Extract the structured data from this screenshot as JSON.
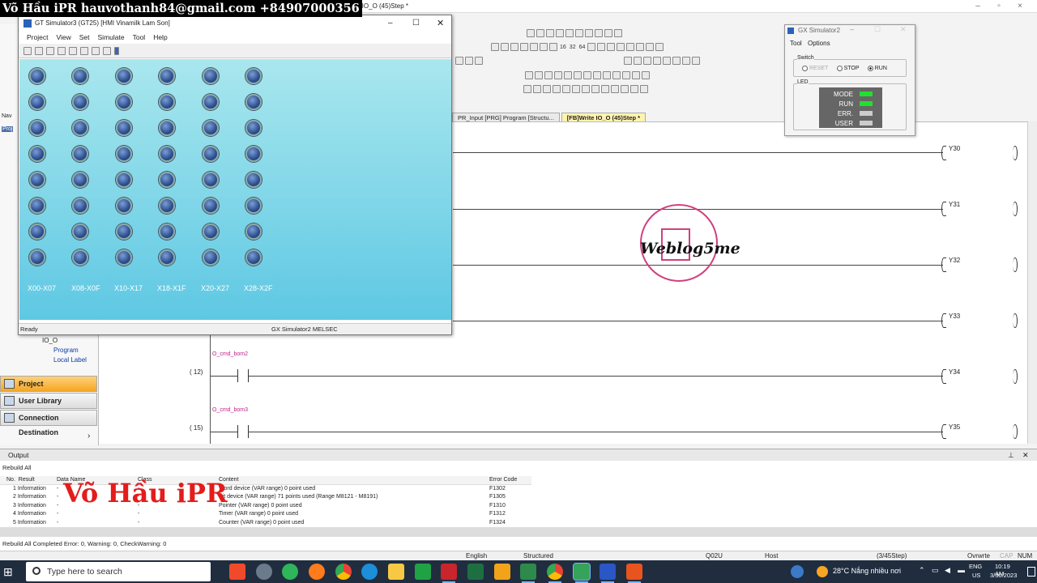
{
  "banner": {
    "text": "Võ Hầu iPR hauvothanh84@gmail.com +84907000356"
  },
  "ide": {
    "title": "e IO_O (45)Step *",
    "tabs": [
      {
        "label": "PR_Input [PRG] Program [Structu..."
      },
      {
        "label": "[FB]Write IO_O (45)Step *"
      }
    ],
    "toolbar_text": [
      "16",
      "32",
      "64"
    ],
    "coils": [
      "Y30",
      "Y31",
      "Y32",
      "Y33",
      "Y34",
      "Y35"
    ],
    "steps": [
      "(    12)",
      "(    15)"
    ],
    "contacts": [
      "O_cmd_bom2",
      "O_cmd_bom3"
    ]
  },
  "navigator": {
    "tree": {
      "folder": "IO_O",
      "program": "Program",
      "local_label": "Local Label"
    },
    "buttons": [
      "Project",
      "User Library",
      "Connection Destination"
    ],
    "side_labels": [
      "Nav",
      "Proj"
    ]
  },
  "gt_sim": {
    "title": "GT Simulator3 (GT25)  [HMI Vinamilk Lam Son]",
    "menu": [
      "Project",
      "View",
      "Set",
      "Simulate",
      "Tool",
      "Help"
    ],
    "columns": [
      "X00-X07",
      "X08-X0F",
      "X10-X17",
      "X18-X1F",
      "X20-X27",
      "X28-X2F"
    ],
    "lamp_rows": 8,
    "status_left": "Ready",
    "status_right": "GX Simulator2   MELSEC"
  },
  "gx_sim": {
    "title": "GX Simulator2",
    "menu": [
      "Tool",
      "Options"
    ],
    "switch_label": "Switch",
    "switch_options": [
      "RESET",
      "STOP",
      "RUN"
    ],
    "switch_selected": "RUN",
    "led_label": "LED",
    "leds": [
      {
        "name": "MODE",
        "color": "#22e02e"
      },
      {
        "name": "RUN",
        "color": "#22e02e"
      },
      {
        "name": "ERR.",
        "color": "#cccccc"
      },
      {
        "name": "USER",
        "color": "#cccccc"
      }
    ]
  },
  "watermark": {
    "text": "Weblog5me",
    "overlay": "Võ Hầu iPR"
  },
  "output": {
    "title": "Output",
    "subtitle": "Rebuild All",
    "headers": [
      "No.",
      "Result",
      "Data Name",
      "Class",
      "Content",
      "Error Code"
    ],
    "rows": [
      {
        "no": "1",
        "result": "Information",
        "data": "-",
        "cls": "-",
        "content": "Word device (VAR range) 0 point used",
        "code": "F1302"
      },
      {
        "no": "2",
        "result": "Information",
        "data": "-",
        "cls": "-",
        "content": "Bit device (VAR range) 71 points used (Range M8121 - M8191)",
        "code": "F1305"
      },
      {
        "no": "3",
        "result": "Information",
        "data": "-",
        "cls": "-",
        "content": "Pointer (VAR range) 0 point used",
        "code": "F1310"
      },
      {
        "no": "4",
        "result": "Information",
        "data": "-",
        "cls": "-",
        "content": "Timer (VAR range) 0 point used",
        "code": "F1312"
      },
      {
        "no": "5",
        "result": "Information",
        "data": "-",
        "cls": "-",
        "content": "Counter (VAR range) 0 point used",
        "code": "F1324"
      }
    ],
    "footer": "Rebuild All Completed Error: 0, Warning: 0, CheckWarning: 0"
  },
  "statusbar": {
    "language": "English",
    "mode": "Structured",
    "cpu": "Q02U",
    "host": "Host",
    "step": "(3/45Step)",
    "ovr": "Ovrwrte",
    "cap": "CAP",
    "num": "NUM"
  },
  "taskbar": {
    "search_placeholder": "Type here to search",
    "weather": "28°C  Nắng nhiều nơi",
    "lang": "ENG",
    "region": "US",
    "time": "10:19 AM",
    "date": "3/30/2023"
  }
}
